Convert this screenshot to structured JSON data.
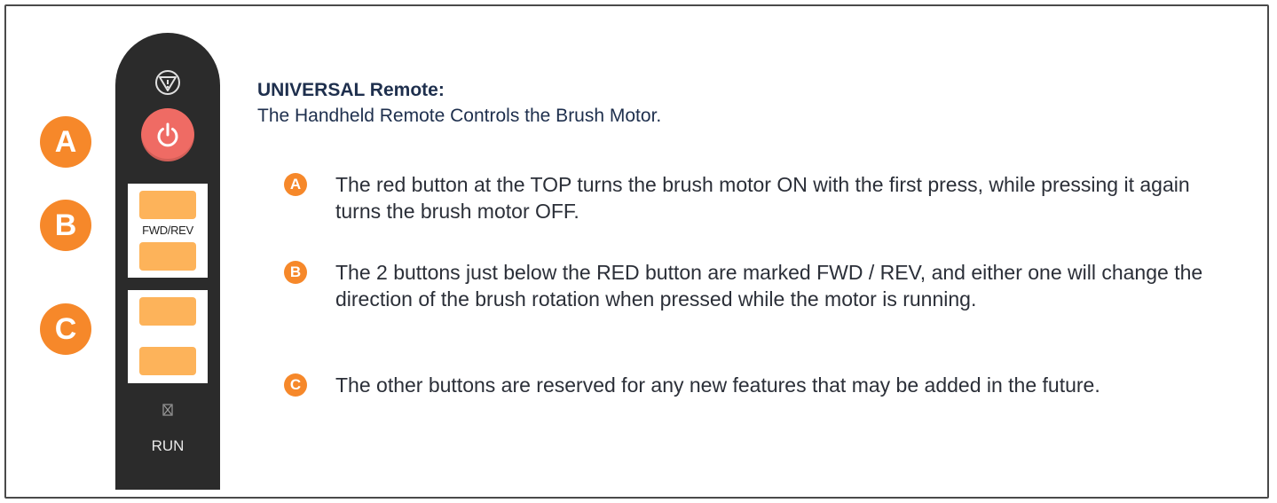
{
  "remote": {
    "fwd_rev_label": "FWD/REV",
    "run_label": "RUN",
    "colors": {
      "body": "#2b2b2b",
      "power": "#ef6b64",
      "key": "#fdb35a",
      "badge": "#f6882a"
    },
    "icons": [
      "emergency-stop-icon",
      "power-icon",
      "mute-icon"
    ]
  },
  "badges": {
    "a": "A",
    "b": "B",
    "c": "C"
  },
  "heading": {
    "title": "UNIVERSAL Remote:",
    "subtitle": "The Handheld Remote Controls the Brush Motor."
  },
  "items": [
    {
      "letter": "A",
      "text": "The red button at the TOP turns the brush motor ON with the first press, while pressing it again turns the brush motor OFF."
    },
    {
      "letter": "B",
      "text": "The 2 buttons just below the RED button are marked FWD / REV, and either one will change the direction of the brush rotation when pressed while the motor is running."
    },
    {
      "letter": "C",
      "text": "The other buttons are reserved for any new features that may be added in the future."
    }
  ]
}
